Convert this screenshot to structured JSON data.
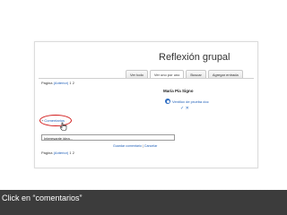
{
  "page": {
    "title": "Reflexión grupal"
  },
  "tabs": [
    {
      "label": "Ver todo",
      "active": false
    },
    {
      "label": "Ver uno por uno",
      "active": true
    },
    {
      "label": "Buscar",
      "active": false
    },
    {
      "label": "Agregar entrada",
      "active": false
    }
  ],
  "pager": {
    "label": "Página",
    "prev": "(Anterior)",
    "pages": "1 2"
  },
  "entry": {
    "author": "María Pía Signo",
    "post_link": "Ventilox de prueba doc",
    "vote_icons": "✓ ✕"
  },
  "comments": {
    "plus": "+",
    "link": "Comentarios",
    "input_value": "Interesante idea...",
    "save_label": "Guardar comentario",
    "separator": "|",
    "cancel_label": "Cancelar"
  },
  "caption": "Click en “comentarios”",
  "colors": {
    "highlight": "#d21c1c",
    "link": "#1f5fb8",
    "caption_bg": "#3c3c3c"
  }
}
